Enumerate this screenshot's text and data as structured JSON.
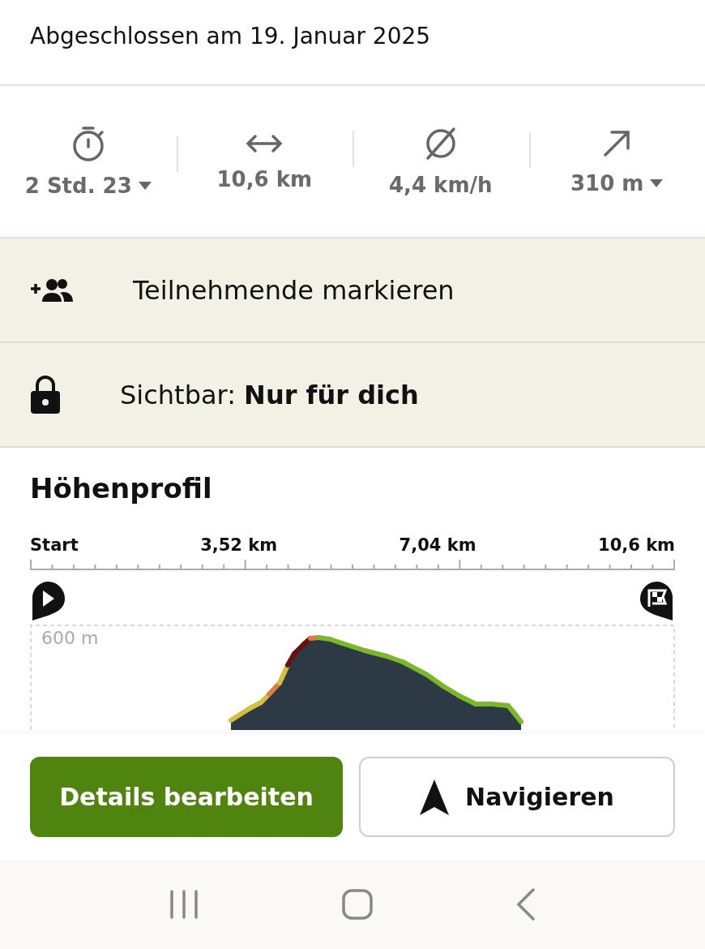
{
  "header": {
    "completed": "Abgeschlossen am 19. Januar 2025"
  },
  "stats": [
    {
      "kind": "duration",
      "value": "2 Std. 23",
      "dropdown": true
    },
    {
      "kind": "distance",
      "value": "10,6 km",
      "dropdown": false
    },
    {
      "kind": "speed",
      "value": "4,4 km/h",
      "dropdown": false
    },
    {
      "kind": "ascent",
      "value": "310 m",
      "dropdown": true
    }
  ],
  "actions": [
    {
      "kind": "participants",
      "label": "Teilnehmende markieren"
    },
    {
      "kind": "visibility",
      "label": "Sichtbar: **Nur für dich**"
    }
  ],
  "elevation": {
    "title": "Höhenprofil",
    "axis_labels": [
      "Start",
      "3,52 km",
      "7,04 km",
      "10,6 km"
    ],
    "y_label": "600 m"
  },
  "buttons": [
    {
      "kind": "primary",
      "label": "Details bearbeiten"
    },
    {
      "kind": "navigate",
      "label": "Navigieren"
    }
  ]
}
